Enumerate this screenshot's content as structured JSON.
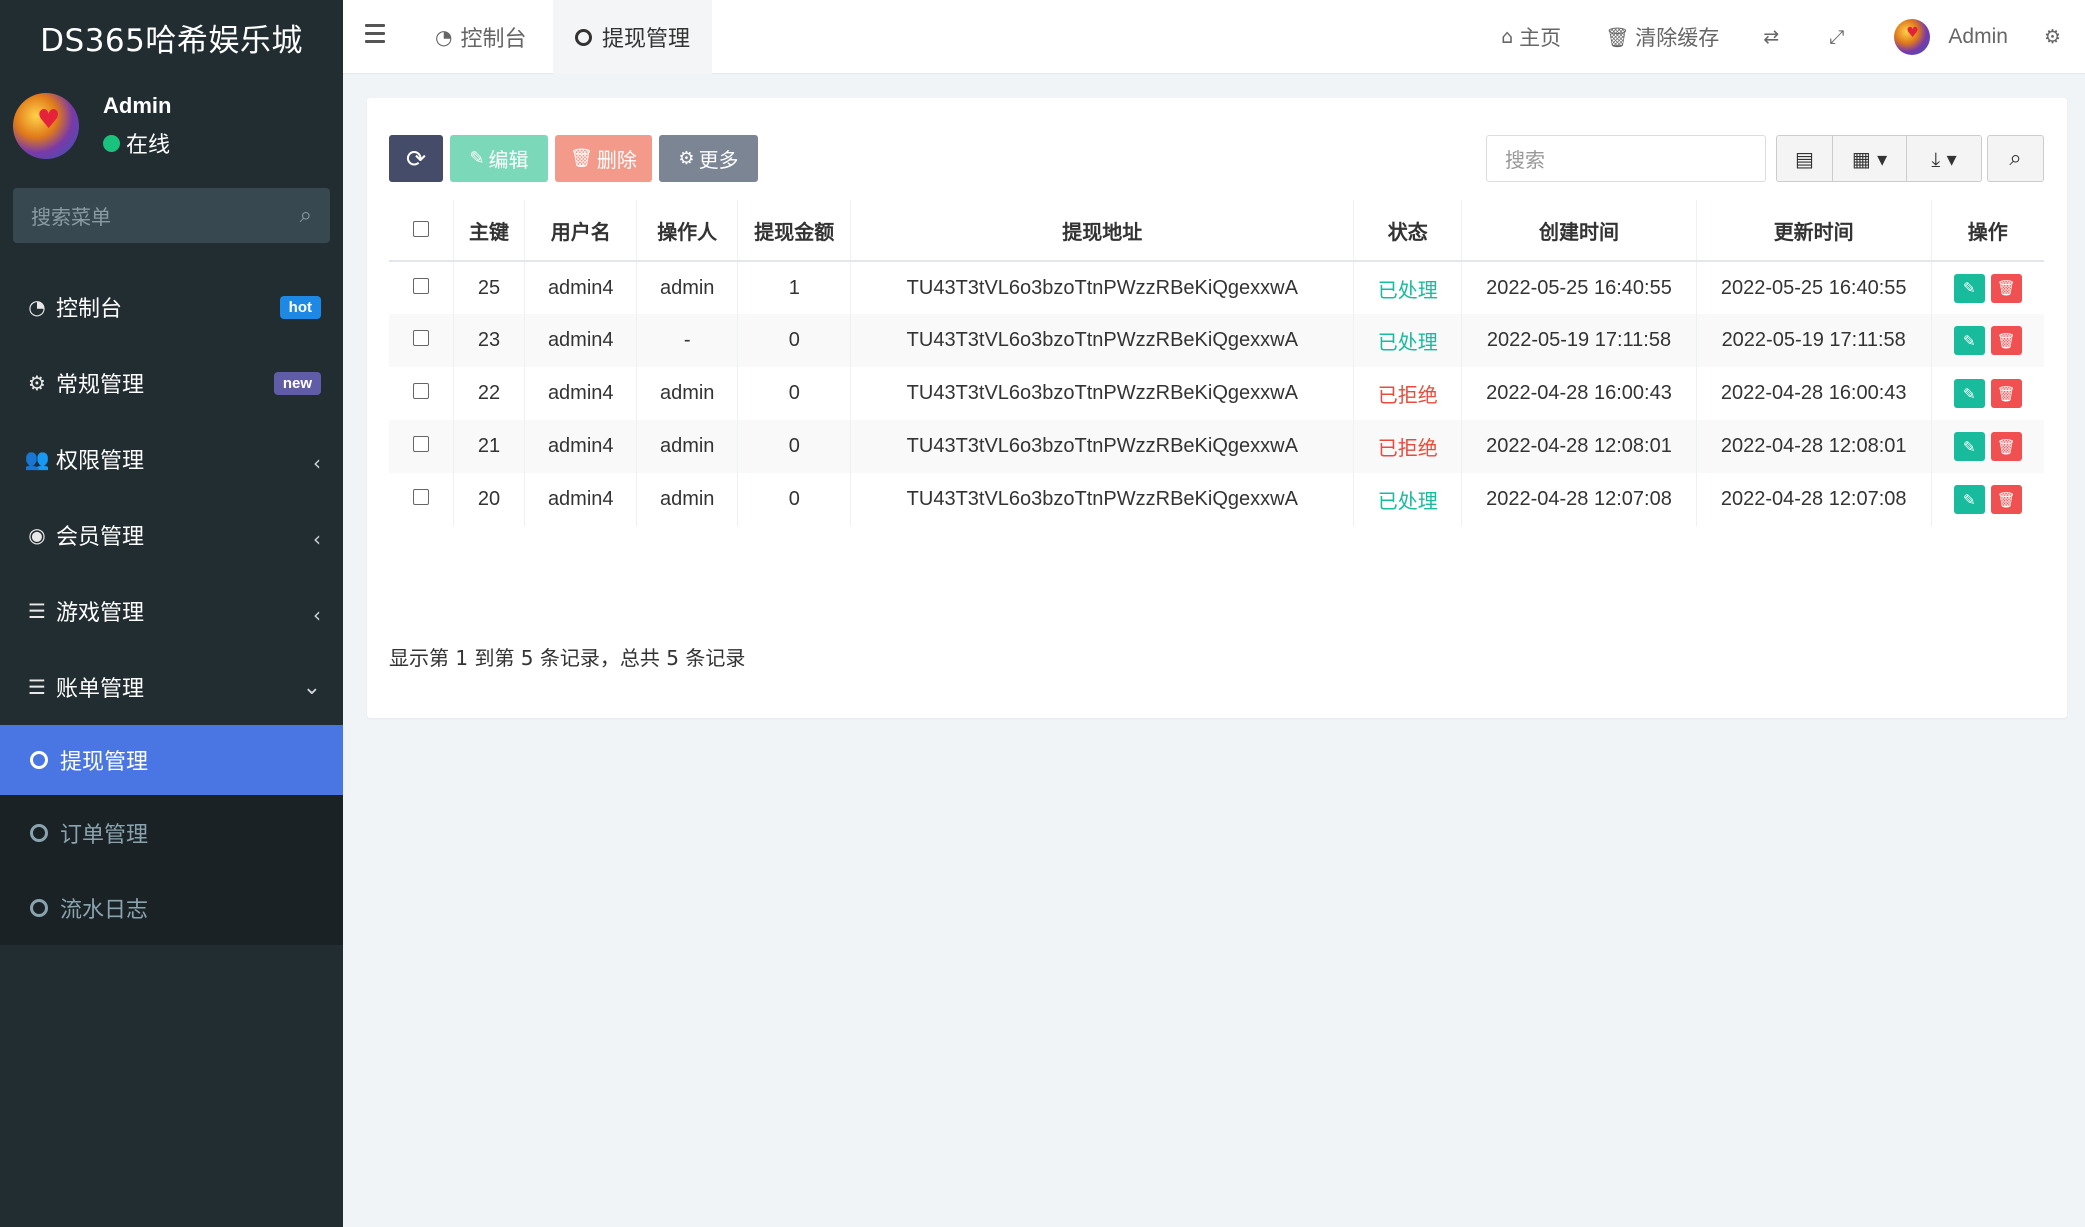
{
  "app": {
    "title": "DS365哈希娱乐城",
    "user_name": "Admin",
    "user_status": "在线",
    "search_placeholder": "搜索菜单"
  },
  "menu": [
    {
      "icon": "dashboard-icon",
      "label": "控制台",
      "badge": "hot"
    },
    {
      "icon": "cogs-icon",
      "label": "常规管理",
      "badge": "new"
    },
    {
      "icon": "users-icon",
      "label": "权限管理",
      "chevron": "‹"
    },
    {
      "icon": "user-circle-icon",
      "label": "会员管理",
      "chevron": "‹"
    },
    {
      "icon": "list-icon",
      "label": "游戏管理",
      "chevron": "‹"
    },
    {
      "icon": "list-icon",
      "label": "账单管理",
      "chevron": "⌄"
    }
  ],
  "submenu": [
    {
      "label": "提现管理",
      "active": true
    },
    {
      "label": "订单管理",
      "active": false
    },
    {
      "label": "流水日志",
      "active": false
    }
  ],
  "topbar": {
    "tab_dashboard": "控制台",
    "tab_withdraw": "提现管理",
    "home": "主页",
    "clear_cache": "清除缓存",
    "admin": "Admin"
  },
  "toolbar": {
    "edit": "编辑",
    "delete": "删除",
    "more": "更多",
    "search_placeholder": "搜索"
  },
  "table": {
    "headers": [
      "主键",
      "用户名",
      "操作人",
      "提现金额",
      "提现地址",
      "状态",
      "创建时间",
      "更新时间",
      "操作"
    ],
    "rows": [
      {
        "id": "25",
        "user": "admin4",
        "operator": "admin",
        "amount": "1",
        "address": "TU43T3tVL6o3bzoTtnPWzzRBeKiQgexxwA",
        "status": "已处理",
        "status_type": "ok",
        "created": "2022-05-25 16:40:55",
        "updated": "2022-05-25 16:40:55"
      },
      {
        "id": "23",
        "user": "admin4",
        "operator": "-",
        "amount": "0",
        "address": "TU43T3tVL6o3bzoTtnPWzzRBeKiQgexxwA",
        "status": "已处理",
        "status_type": "ok",
        "created": "2022-05-19 17:11:58",
        "updated": "2022-05-19 17:11:58"
      },
      {
        "id": "22",
        "user": "admin4",
        "operator": "admin",
        "amount": "0",
        "address": "TU43T3tVL6o3bzoTtnPWzzRBeKiQgexxwA",
        "status": "已拒绝",
        "status_type": "no",
        "created": "2022-04-28 16:00:43",
        "updated": "2022-04-28 16:00:43"
      },
      {
        "id": "21",
        "user": "admin4",
        "operator": "admin",
        "amount": "0",
        "address": "TU43T3tVL6o3bzoTtnPWzzRBeKiQgexxwA",
        "status": "已拒绝",
        "status_type": "no",
        "created": "2022-04-28 12:08:01",
        "updated": "2022-04-28 12:08:01"
      },
      {
        "id": "20",
        "user": "admin4",
        "operator": "admin",
        "amount": "0",
        "address": "TU43T3tVL6o3bzoTtnPWzzRBeKiQgexxwA",
        "status": "已处理",
        "status_type": "ok",
        "created": "2022-04-28 12:07:08",
        "updated": "2022-04-28 12:07:08"
      }
    ]
  },
  "pagination_info": "显示第 1 到第 5 条记录，总共 5 条记录",
  "colors": {
    "sidebar_bg": "#222d32",
    "active_menu": "#4a76e4",
    "status_ok": "#18bc9c",
    "status_rejected": "#e74c3c"
  }
}
